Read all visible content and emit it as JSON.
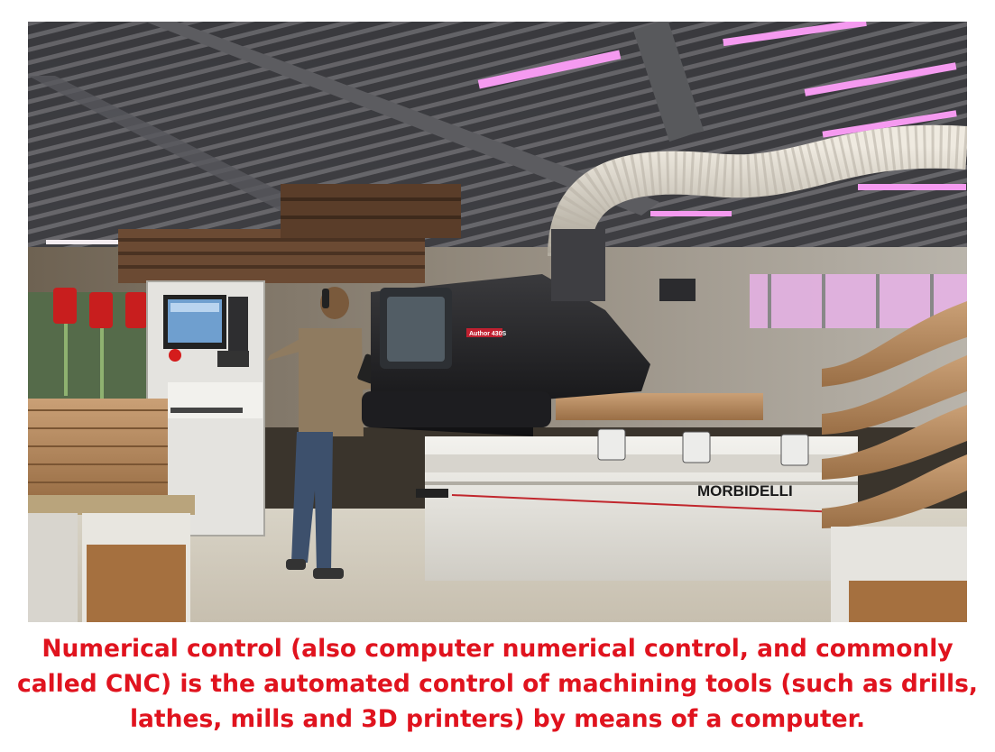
{
  "photo": {
    "machine_brand": "MORBIDELLI",
    "machine_model": "Author 430S"
  },
  "caption": {
    "text": "Numerical control (also computer numerical control, and commonly called CNC) is the automated control of machining tools (such as drills, lathes, mills and 3D printers) by means of a computer."
  },
  "colors": {
    "caption": "#e0131e",
    "machine_body": "#1c1c1e",
    "machine_base": "#e9e7e2",
    "wood": "#b8875a",
    "ceiling": "#4a4a4c",
    "duct": "#d6d1c6",
    "light_tube": "#f59af0"
  }
}
